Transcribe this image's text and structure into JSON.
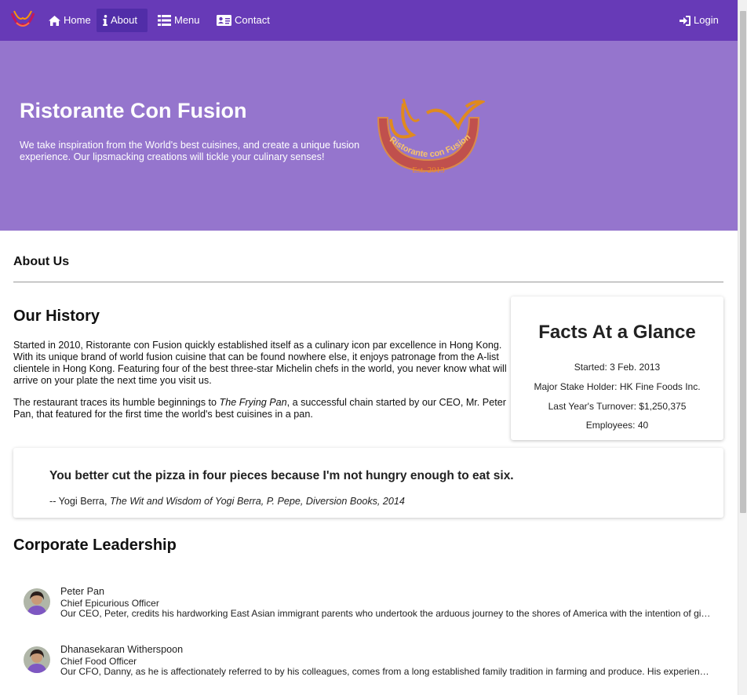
{
  "colors": {
    "primary": "#673ab7",
    "primary_dark": "#512da8",
    "jumbotron": "#9575cd"
  },
  "navbar": {
    "brand_icon": "restaurant-logo-icon",
    "items": [
      {
        "label": "Home",
        "icon": "home-icon",
        "active": false
      },
      {
        "label": "About",
        "icon": "info-icon",
        "active": true
      },
      {
        "label": "Menu",
        "icon": "list-icon",
        "active": false
      },
      {
        "label": "Contact",
        "icon": "address-card-icon",
        "active": false
      }
    ],
    "login": {
      "label": "Login",
      "icon": "sign-in-icon"
    }
  },
  "jumbotron": {
    "title": "Ristorante Con Fusion",
    "text": "We take inspiration from the World's best cuisines, and create a unique fusion experience. Our lipsmacking creations will tickle your culinary senses!",
    "logo_text": "Ristorante con Fusion",
    "logo_est": "Est. 2013"
  },
  "page": {
    "title": "About Us",
    "history": {
      "heading": "Our History",
      "p1": "Started in 2010, Ristorante con Fusion quickly established itself as a culinary icon par excellence in Hong Kong. With its unique brand of world fusion cuisine that can be found nowhere else, it enjoys patronage from the A-list clientele in Hong Kong. Featuring four of the best three-star Michelin chefs in the world, you never know what will arrive on your plate the next time you visit us.",
      "p2_before": "The restaurant traces its humble beginnings to ",
      "p2_italic": "The Frying Pan",
      "p2_after": ", a successful chain started by our CEO, Mr. Peter Pan, that featured for the first time the world's best cuisines in a pan."
    },
    "facts": {
      "title": "Facts At a Glance",
      "items": [
        "Started: 3 Feb. 2013",
        "Major Stake Holder: HK Fine Foods Inc.",
        "Last Year's Turnover: $1,250,375",
        "Employees: 40"
      ]
    },
    "quote": {
      "text": "You better cut the pizza in four pieces because I'm not hungry enough to eat six.",
      "author": "-- Yogi Berra, ",
      "source": "The Wit and Wisdom of Yogi Berra, P. Pepe, Diversion Books, 2014"
    },
    "leadership": {
      "heading": "Corporate Leadership",
      "leaders": [
        {
          "name": "Peter Pan",
          "role": "Chief Epicurious Officer",
          "description": "Our CEO, Peter, credits his hardworking East Asian immigrant parents who undertook the arduous journey to the shores of America with the intention of giving their children the best future."
        },
        {
          "name": "Dhanasekaran Witherspoon",
          "role": "Chief Food Officer",
          "description": "Our CFO, Danny, as he is affectionately referred to by his colleagues, comes from a long established family tradition in farming and produce. His experiences growing up on a farm in the Australian outback gave him a profound appreciation for varieties of food sources."
        }
      ]
    }
  }
}
